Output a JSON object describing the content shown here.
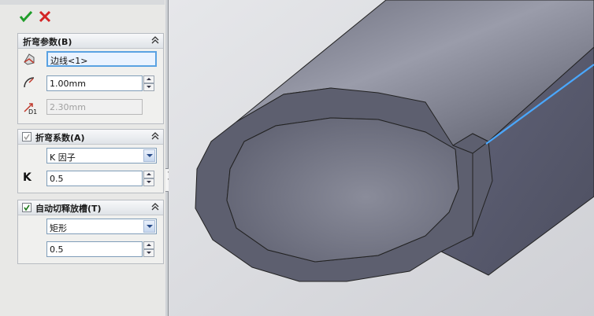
{
  "toolbar": {
    "ok_icon": "green-check-icon",
    "cancel_icon": "red-x-icon"
  },
  "bend_params": {
    "title": "折弯参数(B)",
    "edge_field": "边线<1>",
    "radius_value": "1.00mm",
    "thickness_value": "2.30mm"
  },
  "bend_allowance": {
    "title": "折弯系数(A)",
    "type_selected": "K 因子",
    "k_label": "K",
    "k_value": "0.5"
  },
  "auto_relief": {
    "title": "自动切释放槽(T)",
    "relief_type": "矩形",
    "ratio_value": "0.5"
  },
  "colors": {
    "panel_bg": "#e8e8e6",
    "viewport_bg": "#dcdde1",
    "model": "#5f6170",
    "highlight_edge": "#4aa8ff"
  }
}
